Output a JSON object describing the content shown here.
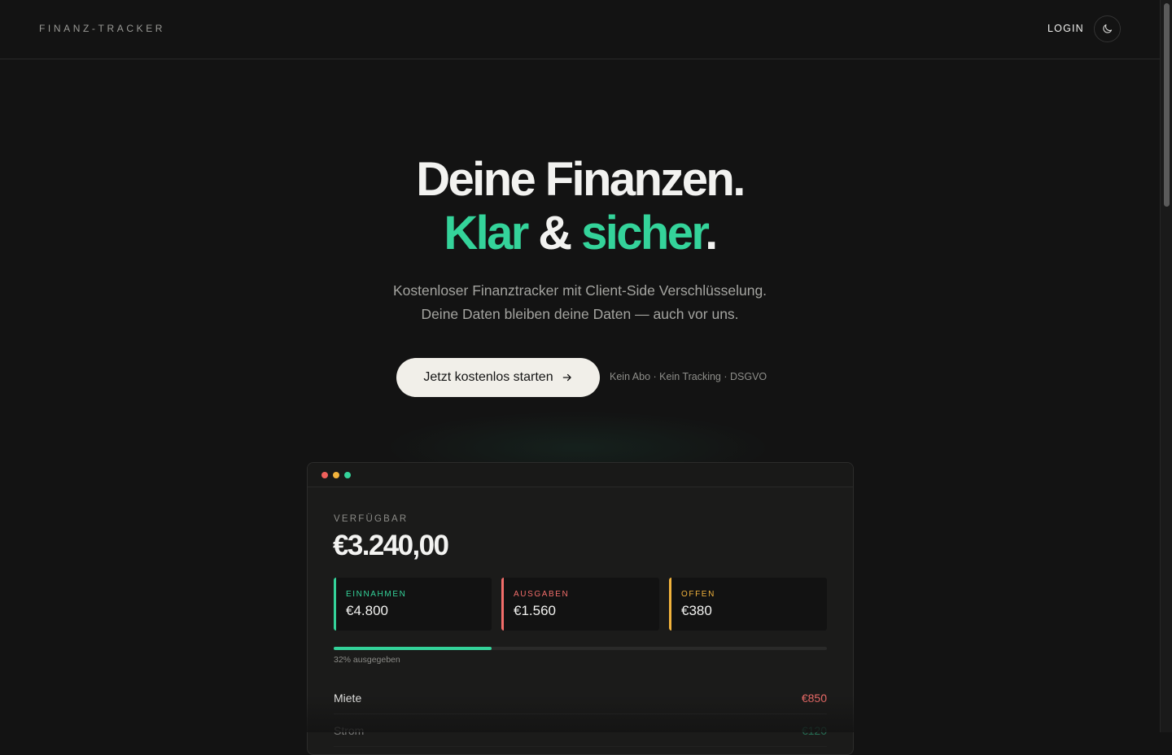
{
  "header": {
    "brand": "FINANZ-TRACKER",
    "login_label": "LOGIN",
    "theme_icon": "moon-icon"
  },
  "hero": {
    "title_line1": "Deine Finanzen.",
    "title_accent1": "Klar",
    "title_amp": " & ",
    "title_accent2": "sicher",
    "title_period": ".",
    "subtitle_line1": "Kostenloser Finanztracker mit Client-Side Verschlüsselung.",
    "subtitle_line2": "Deine Daten bleiben deine Daten — auch vor uns.",
    "cta_label": "Jetzt kostenlos starten",
    "cta_icon": "arrow-right-icon",
    "cta_note": "Kein Abo · Kein Tracking · DSGVO"
  },
  "preview": {
    "available_label": "VERFÜGBAR",
    "available_value": "€3.240,00",
    "stats": [
      {
        "label": "EINNAHMEN",
        "value": "€4.800",
        "color": "#34d39a"
      },
      {
        "label": "AUSGABEN",
        "value": "€1.560",
        "color": "#f26d6a"
      },
      {
        "label": "OFFEN",
        "value": "€380",
        "color": "#f2b33c"
      }
    ],
    "progress": {
      "fraction": 0.32,
      "text": "32% ausgegeben"
    },
    "transactions": [
      {
        "name": "Miete",
        "amount": "€850",
        "color": "#f26d6a"
      },
      {
        "name": "Strom",
        "amount": "€120",
        "color": "#34d39a"
      }
    ]
  },
  "colors": {
    "background": "#131313",
    "accent": "#34d39a",
    "window_dots": [
      "#f0605b",
      "#f2b33c",
      "#34d39a"
    ]
  }
}
